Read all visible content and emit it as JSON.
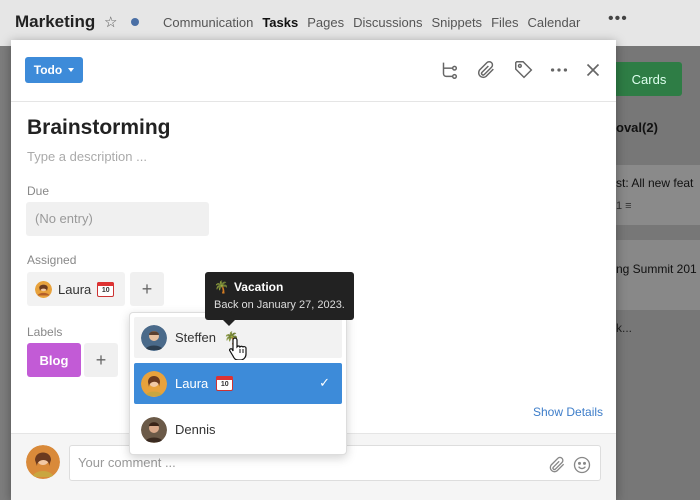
{
  "app": {
    "title": "Marketing",
    "nav": [
      "Communication",
      "Tasks",
      "Pages",
      "Discussions",
      "Snippets",
      "Files",
      "Calendar"
    ],
    "active_nav": "Tasks",
    "more": "•••"
  },
  "background": {
    "cards_button": "Cards",
    "column_title": "oval(2)",
    "card1_text": "st: All new feat",
    "card1_meta": "1 ≡",
    "card2_text": "ng Summit 201",
    "card3_text": "k..."
  },
  "task": {
    "status": "Todo",
    "title": "Brainstorming",
    "description_placeholder": "Type a description ...",
    "due_label": "Due",
    "due_placeholder": "(No entry)",
    "assigned_label": "Assigned",
    "assignee": "Laura",
    "assignee_badge": "10",
    "labels_label": "Labels",
    "labels": [
      "Blog"
    ],
    "show_details": "Show Details",
    "comment_placeholder": "Your comment ..."
  },
  "dropdown": {
    "items": [
      {
        "name": "Steffen",
        "status": "vacation",
        "state": "hover"
      },
      {
        "name": "Laura",
        "status": "calendar",
        "state": "selected"
      },
      {
        "name": "Dennis",
        "status": "",
        "state": "normal"
      }
    ]
  },
  "tooltip": {
    "title": "Vacation",
    "subtitle": "Back on January 27, 2023."
  },
  "colors": {
    "primary": "#3d8bd9",
    "label_blog": "#c25bd6",
    "cards_button": "#2e7d45"
  }
}
